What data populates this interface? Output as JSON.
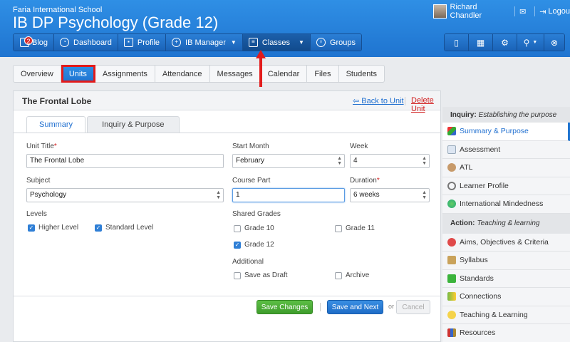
{
  "header": {
    "school": "Faria International School",
    "class_title": "IB DP Psychology (Grade 12)",
    "user_name": "Richard Chandler",
    "logout": "Logou"
  },
  "nav": {
    "badge": "2",
    "items": [
      {
        "label": "Blog",
        "icon": "blog-icon"
      },
      {
        "label": "Dashboard",
        "icon": "dashboard-icon"
      },
      {
        "label": "Profile",
        "icon": "profile-icon"
      },
      {
        "label": "IB Manager",
        "icon": "globe-icon"
      },
      {
        "label": "Classes",
        "icon": "classes-icon"
      },
      {
        "label": "Groups",
        "icon": "groups-icon"
      }
    ]
  },
  "tools": [
    "phone-icon",
    "calendar-icon",
    "gear-icon",
    "search-icon",
    "help-icon"
  ],
  "tabs": [
    "Overview",
    "Units",
    "Assignments",
    "Attendance",
    "Messages",
    "Calendar",
    "Files",
    "Students"
  ],
  "unit": {
    "name": "The Frontal Lobe",
    "back_link": "Back to Unit",
    "delete_link": "Delete Unit"
  },
  "subtabs": [
    "Summary",
    "Inquiry & Purpose"
  ],
  "form": {
    "unit_title_label": "Unit Title",
    "unit_title_value": "The Frontal Lobe",
    "start_month_label": "Start Month",
    "start_month_value": "February",
    "week_label": "Week",
    "week_value": "4",
    "subject_label": "Subject",
    "subject_value": "Psychology",
    "course_part_label": "Course Part",
    "course_part_value": "1",
    "duration_label": "Duration",
    "duration_value": "6 weeks",
    "levels_label": "Levels",
    "higher_level": "Higher Level",
    "standard_level": "Standard Level",
    "shared_grades_label": "Shared Grades",
    "grade10": "Grade 10",
    "grade11": "Grade 11",
    "grade12": "Grade 12",
    "additional_label": "Additional",
    "save_draft": "Save as Draft",
    "archive": "Archive"
  },
  "buttons": {
    "save_changes": "Save Changes",
    "save_next": "Save and Next",
    "or": "or",
    "cancel": "Cancel"
  },
  "sidebar": {
    "section1_title": "Inquiry:",
    "section1_sub": "Establishing the purpose",
    "section1_items": [
      "Summary & Purpose",
      "Assessment",
      "ATL",
      "Learner Profile",
      "International Mindedness"
    ],
    "section2_title": "Action:",
    "section2_sub": "Teaching & learning",
    "section2_items": [
      "Aims, Objectives & Criteria",
      "Syllabus",
      "Standards",
      "Connections",
      "Teaching & Learning",
      "Resources"
    ]
  },
  "colors": {
    "header_blue": "#1f74d0",
    "highlight_red": "#e21b1b",
    "save_green": "#4caf38"
  }
}
